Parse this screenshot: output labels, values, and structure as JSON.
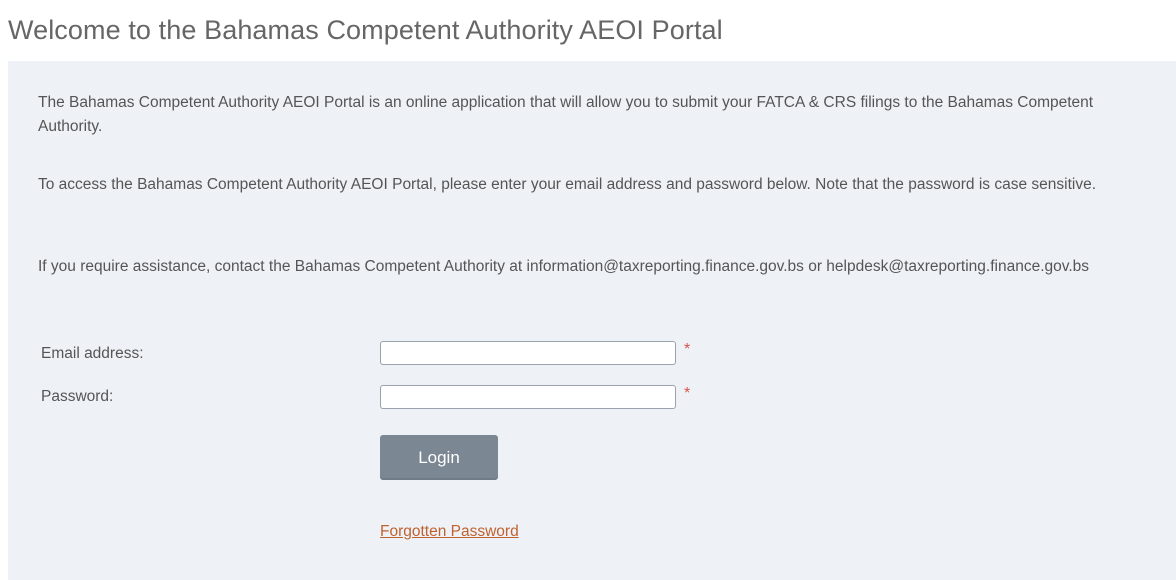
{
  "header": {
    "title": "Welcome to the Bahamas Competent Authority AEOI Portal"
  },
  "intro": {
    "paragraph_1": "The Bahamas Competent Authority AEOI Portal is an online application that will allow you to submit your FATCA & CRS filings to the Bahamas Competent Authority.",
    "paragraph_2": "To access the Bahamas Competent Authority AEOI Portal, please enter your email address and password below. Note that the password is case sensitive.",
    "paragraph_3": "If you require assistance, contact the Bahamas Competent Authority at information@taxreporting.finance.gov.bs or helpdesk@taxreporting.finance.gov.bs"
  },
  "form": {
    "email_label": "Email address:",
    "email_value": "",
    "password_label": "Password:",
    "password_value": "",
    "required_marker": "*",
    "login_label": "Login",
    "forgot_label": "Forgotten Password"
  },
  "colors": {
    "panel_background": "#eef2f7",
    "button_background": "#7b8792",
    "link": "#c0622f",
    "required": "#d9534f"
  }
}
